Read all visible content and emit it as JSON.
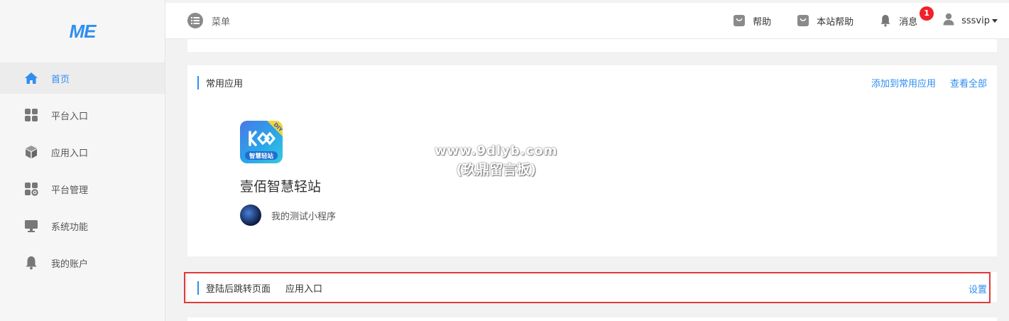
{
  "brand": {
    "logo_text": "ME"
  },
  "sidebar": {
    "items": [
      {
        "label": "首页",
        "icon": "home-icon",
        "active": true
      },
      {
        "label": "平台入口",
        "icon": "grid-icon",
        "active": false
      },
      {
        "label": "应用入口",
        "icon": "cube-icon",
        "active": false
      },
      {
        "label": "平台管理",
        "icon": "grid-gear-icon",
        "active": false
      },
      {
        "label": "系统功能",
        "icon": "monitor-icon",
        "active": false
      },
      {
        "label": "我的账户",
        "icon": "bell-icon",
        "active": false
      }
    ]
  },
  "header": {
    "menu_label": "菜单",
    "help_label": "帮助",
    "site_help_label": "本站帮助",
    "messages_label": "消息",
    "messages_count": "1",
    "username": "sssvip"
  },
  "common_apps": {
    "title": "常用应用",
    "add_label": "添加到常用应用",
    "view_all_label": "查看全部",
    "app": {
      "name": "壹佰智慧轻站",
      "icon_badge": "DIY",
      "icon_caption": "智慧轻站",
      "mini_program_name": "我的测试小程序"
    }
  },
  "watermark": {
    "line1": "www.9dlyb.com",
    "line2": "(玖鼎留言板)"
  },
  "login_redirect": {
    "title": "登陆后跳转页面",
    "value": "应用入口",
    "settings_label": "设置"
  },
  "colors": {
    "accent": "#2f8ef0",
    "highlight_border": "#e03a3a",
    "badge": "#f0202c"
  }
}
